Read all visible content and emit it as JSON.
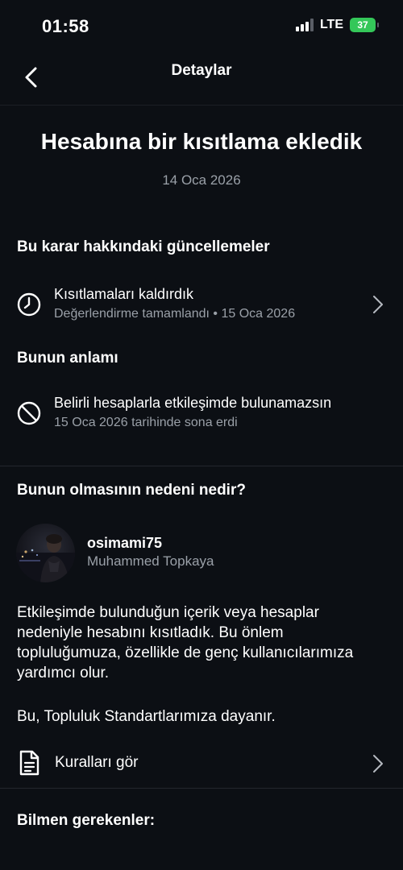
{
  "status_bar": {
    "time": "01:58",
    "network": "LTE",
    "battery": "37"
  },
  "header": {
    "title": "Detaylar"
  },
  "headline": "Hesabına bir kısıtlama ekledik",
  "date": "14 Oca 2026",
  "updates": {
    "title": "Bu karar hakkındaki güncellemeler",
    "item": {
      "primary": "Kısıtlamaları kaldırdık",
      "secondary": "Değerlendirme tamamlandı • 15 Oca 2026"
    }
  },
  "meaning": {
    "title": "Bunun anlamı",
    "item": {
      "primary": "Belirli hesaplarla etkileşimde bulunamazsın",
      "secondary": "15 Oca 2026 tarihinde sona erdi"
    }
  },
  "reason": {
    "title": "Bunun olmasının nedeni nedir?",
    "account": {
      "username": "osimami75",
      "full_name": "Muhammed Topkaya"
    },
    "paragraph1": "Etkileşimde bulunduğun içerik veya hesaplar nedeniyle hesabını kısıtladık. Bu önlem topluluğumuza, özellikle de genç kullanıcılarımıza yardımcı olur.",
    "paragraph2": "Bu, Topluluk Standartlarımıza dayanır.",
    "rules_link": "Kuralları gör"
  },
  "know": {
    "title": "Bilmen gerekenler:"
  },
  "colors": {
    "background": "#0c0f14",
    "secondary_text": "#9aa0a8",
    "battery": "#34c759"
  }
}
